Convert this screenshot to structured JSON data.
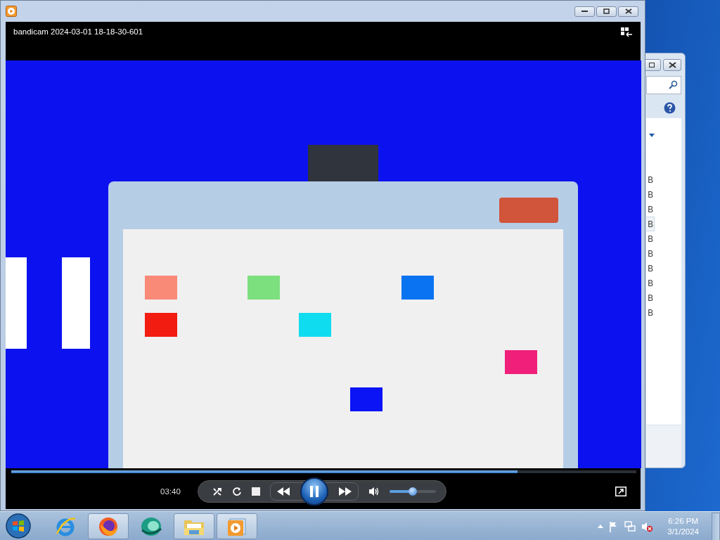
{
  "player": {
    "title": "bandicam 2024-03-01 18-18-30-601",
    "seek": {
      "level": 0.81
    },
    "time": "03:40",
    "playing": true,
    "volume": {
      "level": 0.5
    }
  },
  "background_window": {
    "rows": [
      {
        "text": "B",
        "selected": false
      },
      {
        "text": "B",
        "selected": false
      },
      {
        "text": "B",
        "selected": false
      },
      {
        "text": "B",
        "selected": true
      },
      {
        "text": "B",
        "selected": false
      },
      {
        "text": "B",
        "selected": false
      },
      {
        "text": "B",
        "selected": false
      },
      {
        "text": "B",
        "selected": false
      },
      {
        "text": "B",
        "selected": false
      },
      {
        "text": "B",
        "selected": false
      }
    ]
  },
  "taskbar": {
    "apps": [
      {
        "kind": "ie",
        "active": false
      },
      {
        "kind": "firefox",
        "active": true
      },
      {
        "kind": "sphere",
        "active": false
      },
      {
        "kind": "explorer",
        "active": true
      },
      {
        "kind": "player",
        "active": true
      }
    ],
    "clock": {
      "time": "6:26 PM",
      "date": "3/1/2024"
    }
  }
}
